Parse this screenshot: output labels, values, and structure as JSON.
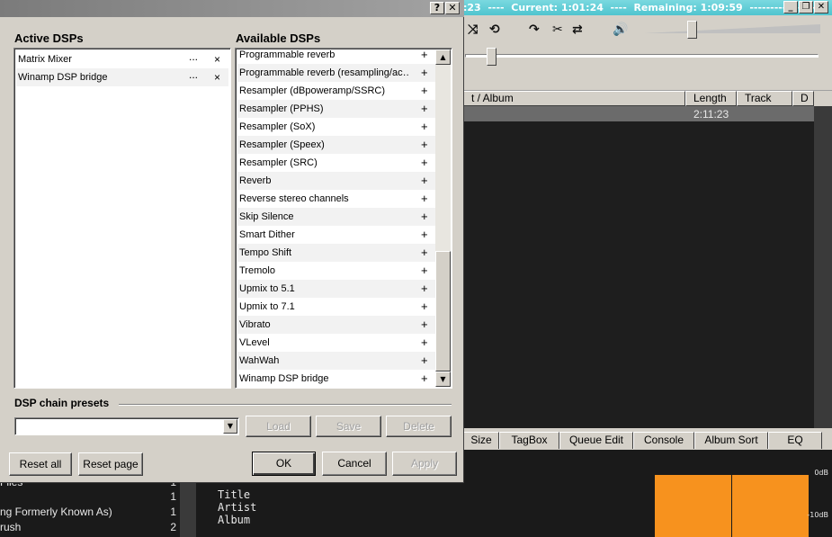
{
  "player": {
    "title_text": ":23  ----  Current: 1:01:24  ----  Remaining: 1:09:59  ----------------",
    "window_buttons": [
      "_",
      "❐",
      "✕"
    ],
    "playlist_columns": [
      "t / Album",
      "Length",
      "Track",
      "D"
    ],
    "playlist_row": {
      "length": "2:11:23"
    },
    "tabs": [
      "Size",
      "TagBox",
      "Queue Edit",
      "Console",
      "Album Sort",
      "EQ"
    ],
    "library_rows": [
      {
        "name": "Files",
        "count": "1"
      },
      {
        "name": "",
        "count": "1"
      },
      {
        "name": "ng Formerly Known As)",
        "count": "1"
      },
      {
        "name": "rush",
        "count": "2"
      }
    ],
    "info_lines": [
      "Title",
      "Artist",
      "Album"
    ],
    "viz": {
      "label_top": "0dB",
      "label_bottom": "-10dB",
      "accent": "#f7921e"
    }
  },
  "dialog": {
    "help_button": "?",
    "close_button": "✕",
    "active_label": "Active DSPs",
    "available_label": "Available DSPs",
    "active_dsps": [
      "Matrix Mixer",
      "Winamp DSP bridge"
    ],
    "configure_glyph": "...",
    "remove_glyph": "×",
    "add_glyph": "+",
    "available_dsps": [
      "Programmable reverb",
      "Programmable reverb (resampling/ac…",
      "Resampler (dBpoweramp/SSRC)",
      "Resampler (PPHS)",
      "Resampler (SoX)",
      "Resampler (Speex)",
      "Resampler (SRC)",
      "Reverb",
      "Reverse stereo channels",
      "Skip Silence",
      "Smart Dither",
      "Tempo Shift",
      "Tremolo",
      "Upmix to 5.1",
      "Upmix to 7.1",
      "Vibrato",
      "VLevel",
      "WahWah",
      "Winamp DSP bridge"
    ],
    "presets_label": "DSP chain presets",
    "preset_value": "",
    "load_label": "Load",
    "save_label": "Save",
    "delete_label": "Delete",
    "reset_all_label": "Reset all",
    "reset_page_label": "Reset page",
    "ok_label": "OK",
    "cancel_label": "Cancel",
    "apply_label": "Apply"
  }
}
